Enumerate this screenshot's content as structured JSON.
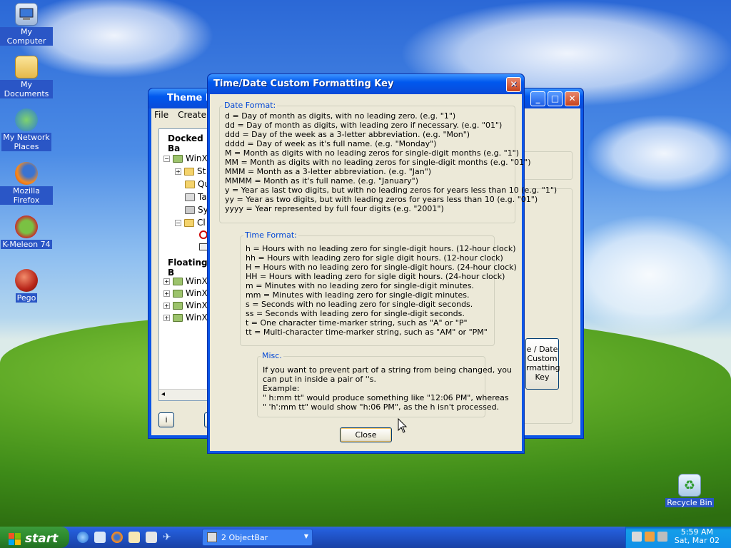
{
  "desktop": {
    "icons": [
      {
        "label": "My Computer"
      },
      {
        "label": "My Documents"
      },
      {
        "label": "My Network Places"
      },
      {
        "label": "Mozilla Firefox"
      },
      {
        "label": "K-Meleon 74"
      },
      {
        "label": "Pego"
      },
      {
        "label": "Recycle Bin"
      }
    ]
  },
  "theme_editor": {
    "title": "Theme Ec",
    "menu": [
      "File",
      "Create"
    ],
    "docked_label": "Docked Ba",
    "floating_label": "Floating B",
    "docked_items": [
      "WinX",
      "St",
      "Qu",
      "Ta",
      "Sy",
      "Cl"
    ],
    "floating_items": [
      "WinXI",
      "WinXI",
      "WinXI",
      "WinXI"
    ],
    "side_button": "e / Date\nCustom\nrmatting\nKey",
    "bottom_button": "i"
  },
  "dialog": {
    "title": "Time/Date Custom Formatting Key",
    "date_format": {
      "title": "Date Format:",
      "lines": [
        "d = Day of month as digits, with no leading zero. (e.g. \"1\")",
        "dd = Day of month as digits, with leading zero if necessary. (e.g. \"01\")",
        "ddd = Day of the week as a 3-letter abbreviation. (e.g. \"Mon\")",
        "dddd = Day of week as it's full name. (e.g. \"Monday\")",
        "M = Month as digits with no leading zeros for single-digit months (e.g. \"1\")",
        "MM = Month as digits with no leading zeros for single-digit months (e.g. \"01\")",
        "MMM = Month as a 3-letter abbreviation. (e.g. \"Jan\")",
        "MMMM = Month as it's full name. (e.g. \"January\")",
        "y = Year as last two digits, but with no leading zeros for years less than 10 (e.g. \"1\")",
        "yy = Year as two digits, but with leading zeros for years less than 10 (e.g. \"01\")",
        "yyyy = Year represented by full four digits (e.g. \"2001\")"
      ]
    },
    "time_format": {
      "title": "Time Format:",
      "lines": [
        "h = Hours with no leading zero for single-digit hours. (12-hour clock)",
        "hh = Hours with leading zero for sigle digit hours. (12-hour clock)",
        "H = Hours with no leading zero for single-digit hours. (24-hour clock)",
        "HH = Hours with leading zero for sigle digit hours. (24-hour clock)",
        "m = Minutes with no leading zero for single-digit minutes.",
        "mm = Minutes with leading zero for single-digit minutes.",
        "s = Seconds with no leading zero for single-digit seconds.",
        "ss = Seconds with leading zero for single-digit seconds.",
        "t = One character time-marker string, such as \"A\" or \"P\"",
        "tt = Multi-character time-marker string, such as \"AM\" or \"PM\""
      ]
    },
    "misc": {
      "title": "Misc.",
      "lines": [
        "If you want to prevent part of a string from being changed, you",
        "can put in inside a pair of ''s.",
        "Example:",
        "\" h:mm tt\" would produce something like \"12:06 PM\", whereas",
        "\" 'h':mm tt\" would show \"h:06 PM\", as the h isn't processed."
      ]
    },
    "close_label": "Close"
  },
  "taskbar": {
    "start_label": "start",
    "task_label": "2 ObjectBar",
    "clock_time": "5:59 AM",
    "clock_date": "Sat, Mar 02"
  }
}
